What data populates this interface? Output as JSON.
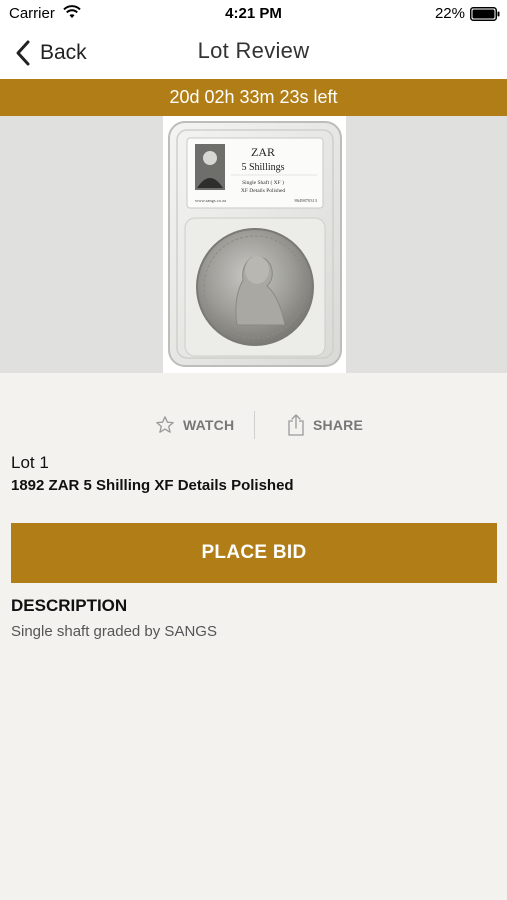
{
  "status_bar": {
    "carrier": "Carrier",
    "time": "4:21 PM",
    "battery": "22%"
  },
  "nav": {
    "back_label": "Back",
    "title": "Lot Review"
  },
  "countdown": "20d 02h 33m 23s left",
  "lot_image": {
    "label_title": "ZAR",
    "label_denomination": "5 Shillings",
    "label_line1": "Single Shaft ( XF )",
    "label_line2": "XF Details Polished",
    "label_site": "www.sangs.co.za",
    "label_serial": "8649870313"
  },
  "actions": {
    "watch_label": "WATCH",
    "share_label": "SHARE"
  },
  "lot": {
    "number": "Lot 1",
    "title": "1892 ZAR 5 Shilling XF Details Polished"
  },
  "place_bid_label": "PLACE BID",
  "description": {
    "heading": "DESCRIPTION",
    "text": "Single shaft graded by SANGS"
  },
  "colors": {
    "accent": "#b07d17",
    "background": "#f3f2ef",
    "image_backdrop": "#e0e0de"
  }
}
